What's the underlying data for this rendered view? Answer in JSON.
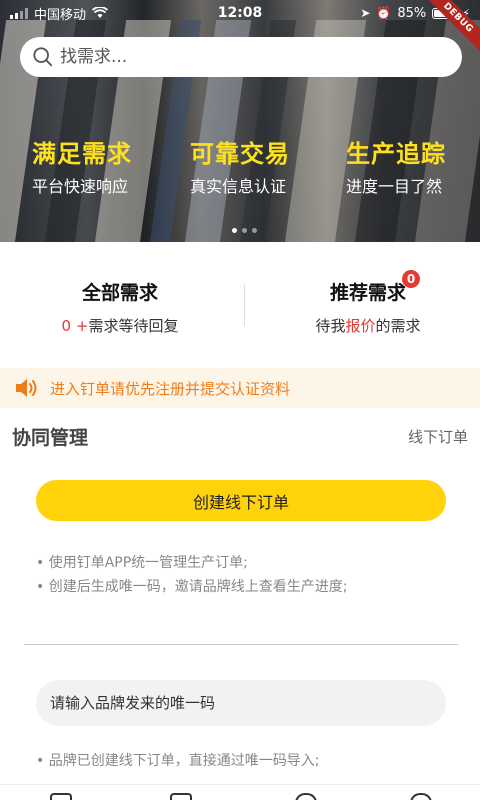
{
  "status_bar": {
    "carrier": "中国移动",
    "time": "12:08",
    "battery": "85%",
    "debug_label": "DEBUG"
  },
  "search": {
    "placeholder": "找需求..."
  },
  "hero": {
    "features": [
      {
        "title": "满足需求",
        "subtitle": "平台快速响应"
      },
      {
        "title": "可靠交易",
        "subtitle": "真实信息认证"
      },
      {
        "title": "生产追踪",
        "subtitle": "进度一目了然"
      }
    ],
    "slide_count": 3,
    "active_slide": 0
  },
  "stats": {
    "all": {
      "title": "全部需求",
      "count": "0 +",
      "suffix": "需求等待回复"
    },
    "recommended": {
      "title": "推荐需求",
      "badge": "0",
      "prefix": "待我",
      "highlight": "报价",
      "suffix": "的需求"
    }
  },
  "notice": {
    "text": "进入钉单请优先注册并提交认证资料"
  },
  "section": {
    "title": "协同管理",
    "link": "线下订单"
  },
  "create_button": {
    "label": "创建线下订单"
  },
  "tips_create": [
    "使用钉单APP统一管理生产订单;",
    "创建后生成唯一码，邀请品牌线上查看生产进度;"
  ],
  "code_input": {
    "placeholder": "请输入品牌发来的唯一码"
  },
  "tips_import": [
    "品牌已创建线下订单，直接通过唯一码导入;"
  ],
  "colors": {
    "accent_yellow": "#ffd20a",
    "hero_title": "#ffe11a",
    "notice_text": "#f07c1a",
    "badge_red": "#e53935"
  }
}
